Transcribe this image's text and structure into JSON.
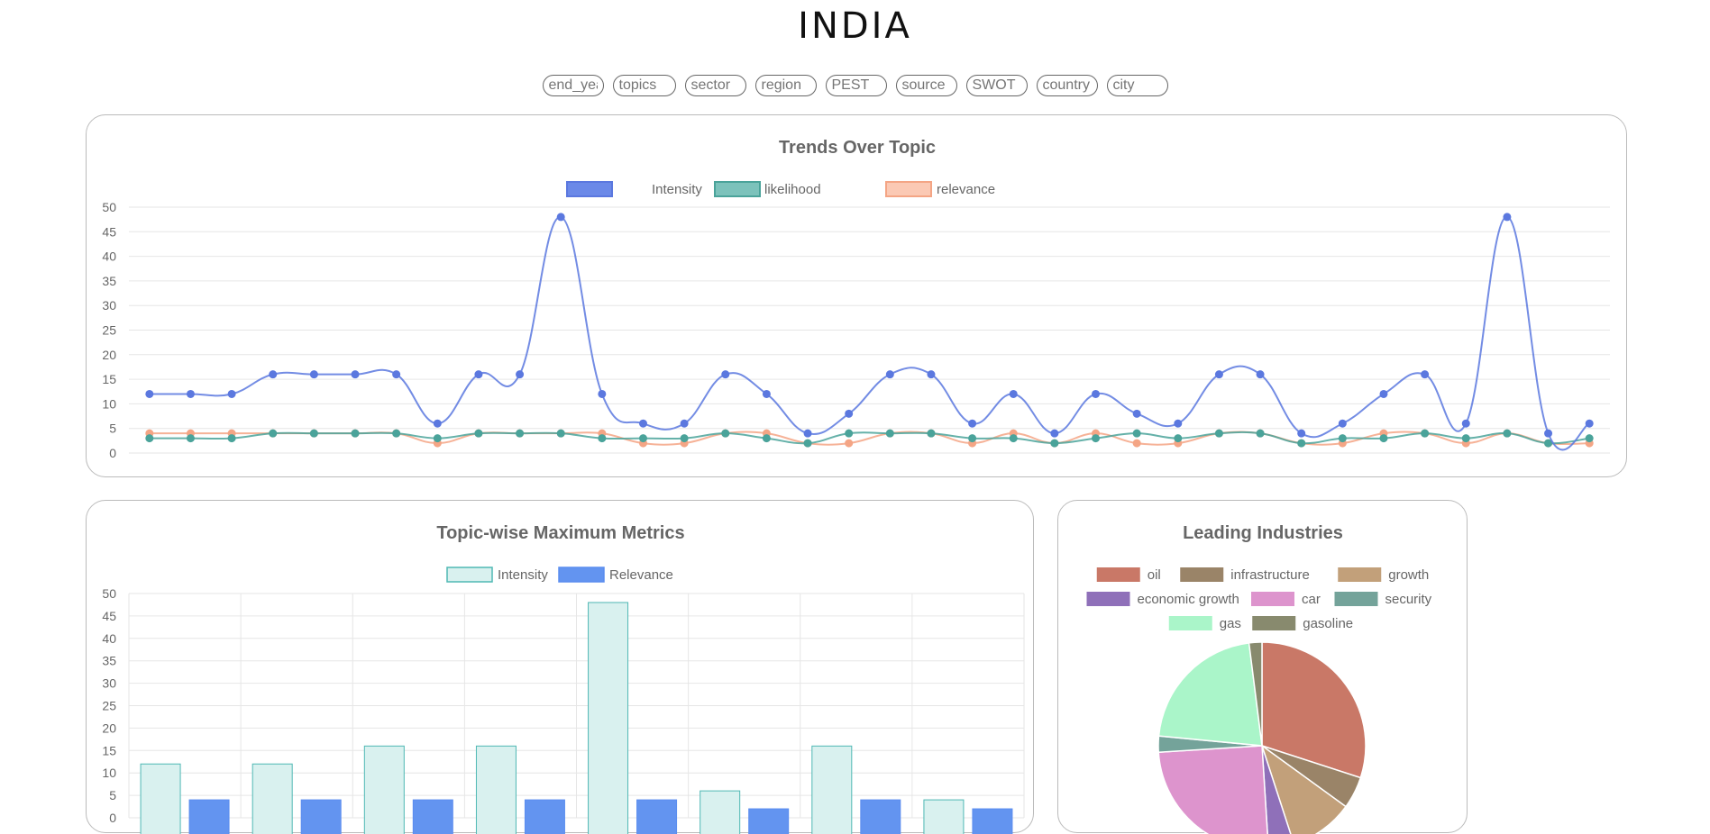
{
  "page": {
    "title": "INDIA"
  },
  "filters": [
    {
      "placeholder": "end_year"
    },
    {
      "placeholder": "topics"
    },
    {
      "placeholder": "sector"
    },
    {
      "placeholder": "region"
    },
    {
      "placeholder": "PEST"
    },
    {
      "placeholder": "source"
    },
    {
      "placeholder": "SWOT"
    },
    {
      "placeholder": "country"
    },
    {
      "placeholder": "city"
    }
  ],
  "chart_data": [
    {
      "type": "line",
      "title": "Trends Over Topic",
      "ylim": [
        0,
        50
      ],
      "yticks": [
        0,
        5,
        10,
        15,
        20,
        25,
        30,
        35,
        40,
        45,
        50
      ],
      "grid": true,
      "legend": "top",
      "series": [
        {
          "name": "Intensity",
          "color": "#5b78df",
          "fill": "#6b89e8",
          "values": [
            12,
            12,
            12,
            16,
            16,
            16,
            16,
            6,
            16,
            16,
            48,
            12,
            6,
            6,
            16,
            12,
            4,
            8,
            16,
            16,
            6,
            12,
            4,
            12,
            8,
            6,
            16,
            16,
            4,
            6,
            12,
            16,
            6,
            48,
            4,
            6
          ]
        },
        {
          "name": "likelihood",
          "color": "#4aa39a",
          "fill": "#7cc2bb",
          "values": [
            3,
            3,
            3,
            4,
            4,
            4,
            4,
            3,
            4,
            4,
            4,
            3,
            3,
            3,
            4,
            3,
            2,
            4,
            4,
            4,
            3,
            3,
            2,
            3,
            4,
            3,
            4,
            4,
            2,
            3,
            3,
            4,
            3,
            4,
            2,
            3
          ]
        },
        {
          "name": "relevance",
          "color": "#f4a585",
          "fill": "#fbc9b4",
          "values": [
            4,
            4,
            4,
            4,
            4,
            4,
            4,
            2,
            4,
            4,
            4,
            4,
            2,
            2,
            4,
            4,
            2,
            2,
            4,
            4,
            2,
            4,
            2,
            4,
            2,
            2,
            4,
            4,
            2,
            2,
            4,
            4,
            2,
            4,
            2,
            2
          ]
        }
      ]
    },
    {
      "type": "bar",
      "title": "Topic-wise Maximum Metrics",
      "ylim": [
        0,
        50
      ],
      "yticks": [
        0,
        5,
        10,
        15,
        20,
        25,
        30,
        35,
        40,
        45,
        50
      ],
      "grid": true,
      "legend": "top",
      "series": [
        {
          "name": "Intensity",
          "color": "#4fb8b4",
          "fill": "#d9f1ef",
          "values": [
            12,
            12,
            16,
            16,
            48,
            6,
            16,
            4
          ]
        },
        {
          "name": "Relevance",
          "color": "#5b8def",
          "fill": "#6394f0",
          "values": [
            4,
            4,
            4,
            4,
            4,
            2,
            4,
            2
          ]
        }
      ]
    },
    {
      "type": "pie",
      "title": "Leading Industries",
      "legend": "top",
      "slices": [
        {
          "label": "oil",
          "value": 30,
          "color": "#c97867"
        },
        {
          "label": "infrastructure",
          "value": 5,
          "color": "#9a8468"
        },
        {
          "label": "growth",
          "value": 10,
          "color": "#c2a07a"
        },
        {
          "label": "economic growth",
          "value": 4,
          "color": "#8f70b9"
        },
        {
          "label": "car",
          "value": 25,
          "color": "#dd94cd"
        },
        {
          "label": "security",
          "value": 2.5,
          "color": "#74a39a"
        },
        {
          "label": "gas",
          "value": 21.5,
          "color": "#aaf5c9"
        },
        {
          "label": "gasoline",
          "value": 2,
          "color": "#888a6e"
        }
      ]
    }
  ]
}
